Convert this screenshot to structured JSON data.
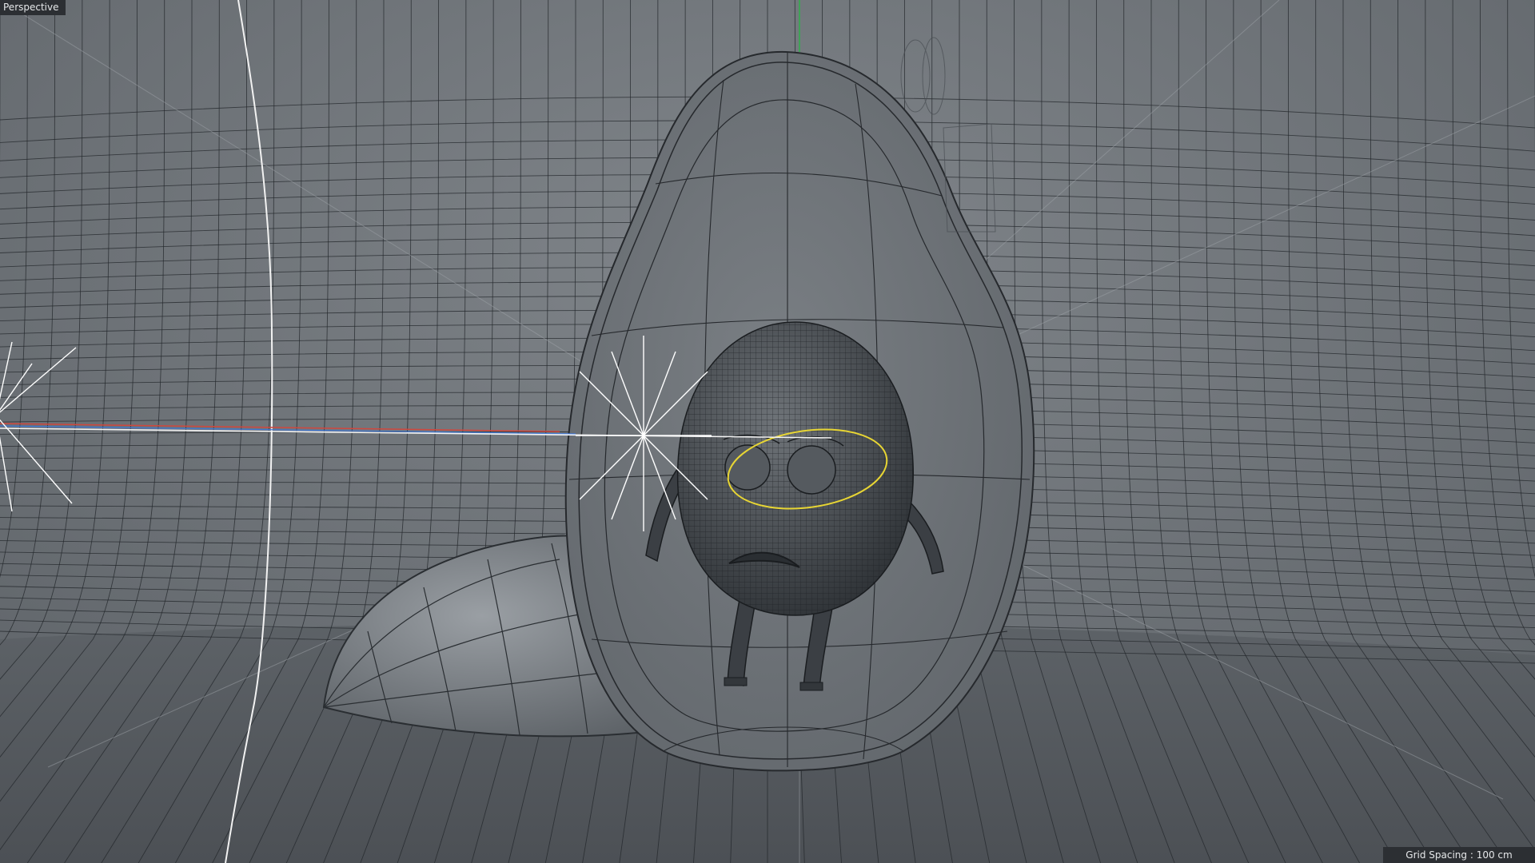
{
  "viewport": {
    "camera_label": "Perspective",
    "grid_spacing_text": "Grid Spacing : 100 cm"
  },
  "scene": {
    "background_color": "#6b7075",
    "floor_color": "#53585d",
    "wire_color": "#23272b",
    "selection_color": "#e7d534",
    "axis_x_color": "#d0473f",
    "axis_y_color": "#2fb04a",
    "axis_z_color": "#3f78d8",
    "light_color": "#ffffff",
    "objects": [
      {
        "name": "backdrop-cyclorama",
        "icon": "wireframe-surface"
      },
      {
        "name": "avocado-shell",
        "icon": "subdivision-object"
      },
      {
        "name": "egg-character",
        "icon": "polygon-object"
      },
      {
        "name": "hemisphere-rock",
        "icon": "polygon-object"
      },
      {
        "name": "omni-light-left",
        "icon": "light-icon"
      },
      {
        "name": "omni-light-center",
        "icon": "light-icon"
      }
    ]
  }
}
